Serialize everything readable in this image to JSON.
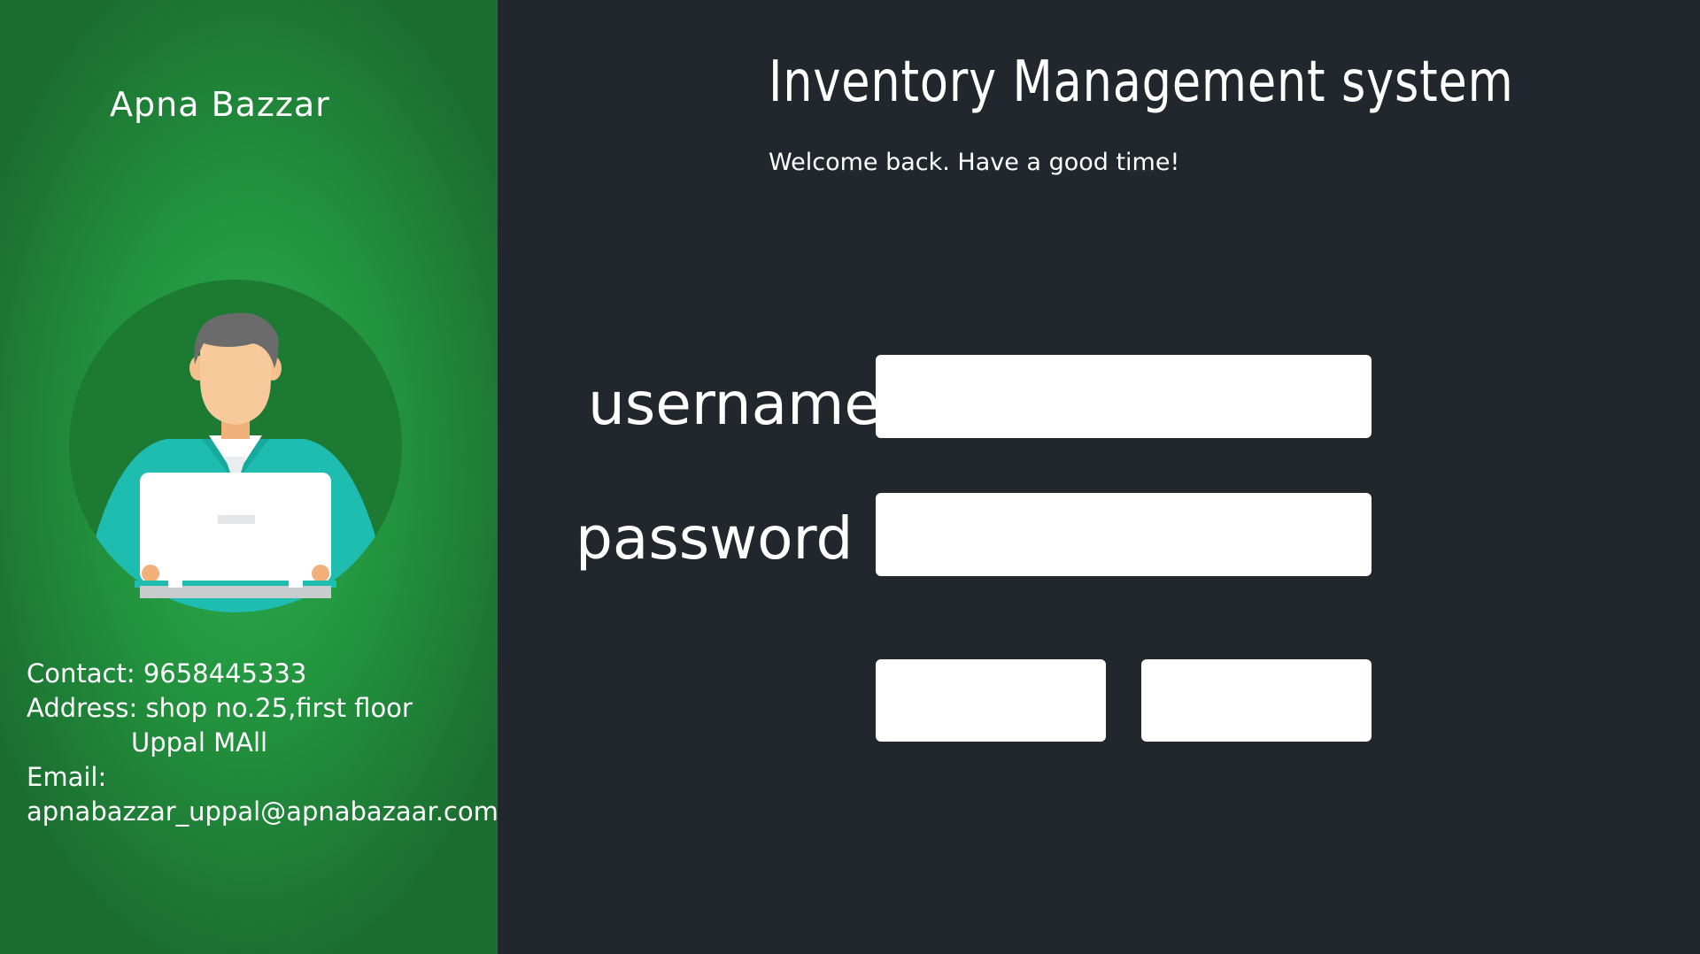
{
  "brand": {
    "name": "Apna Bazzar"
  },
  "header": {
    "title": "Inventory Management system",
    "welcome": "Welcome back. Have a good time!"
  },
  "form": {
    "username_label": "username",
    "username_value": "",
    "password_label": "password",
    "password_value": "",
    "button_left_label": "",
    "button_right_label": ""
  },
  "contact": {
    "contact_line": "Contact: 9658445333",
    "address_line1": "Address: shop no.25,first floor",
    "address_line2": "Uppal MAll",
    "email_label": "Email:",
    "email_value": "apnabazzar_uppal@apnabazaar.com"
  },
  "colors": {
    "left_panel": "#23963f",
    "background": "#22272e",
    "avatar_circle": "#1c7a33",
    "shirt": "#1fbcb0"
  },
  "icons": {
    "avatar": "user-with-laptop-icon"
  }
}
